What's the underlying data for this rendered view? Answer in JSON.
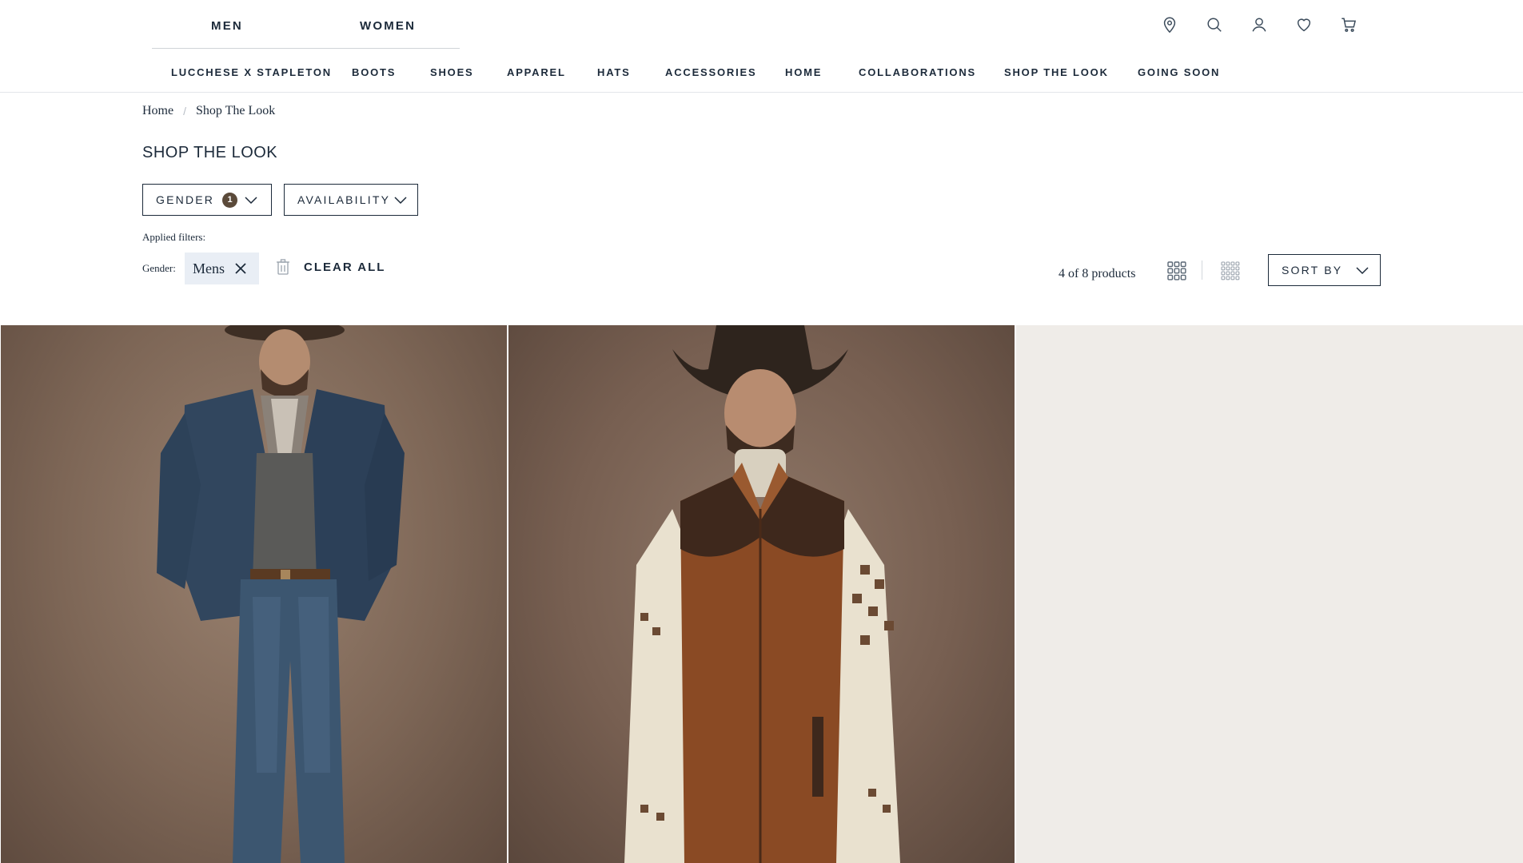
{
  "header": {
    "gender_tabs": [
      "MEN",
      "WOMEN"
    ],
    "utility_icons": [
      "location-pin-icon",
      "search-icon",
      "account-icon",
      "wishlist-heart-icon",
      "cart-icon"
    ]
  },
  "nav": {
    "items": [
      "LUCCHESE X STAPLETON",
      "BOOTS",
      "SHOES",
      "APPAREL",
      "HATS",
      "ACCESSORIES",
      "HOME",
      "COLLABORATIONS",
      "SHOP THE LOOK",
      "GOING SOON"
    ]
  },
  "breadcrumb": {
    "home": "Home",
    "current": "Shop The Look",
    "separator": "/"
  },
  "page_title": "SHOP THE LOOK",
  "filters": {
    "gender_label": "GENDER",
    "gender_count": "1",
    "availability_label": "AVAILABILITY",
    "applied_label": "Applied filters:",
    "applied_gender_prefix": "Gender:",
    "applied_gender_value": "Mens",
    "clear_all": "CLEAR ALL"
  },
  "results": {
    "count_text": "4 of 8 products",
    "sort_label": "SORT BY"
  },
  "products": [
    {
      "image": "man-in-denim-jacket-cowboy-hat-photo"
    },
    {
      "image": "man-in-suede-vest-and-cowboy-hat-photo"
    },
    {
      "image": "empty-beige-placeholder"
    }
  ],
  "colors": {
    "text": "#1c2a3a",
    "chip_bg": "#e9eef5",
    "badge": "#5b4a3a",
    "placeholder": "#efece8"
  }
}
